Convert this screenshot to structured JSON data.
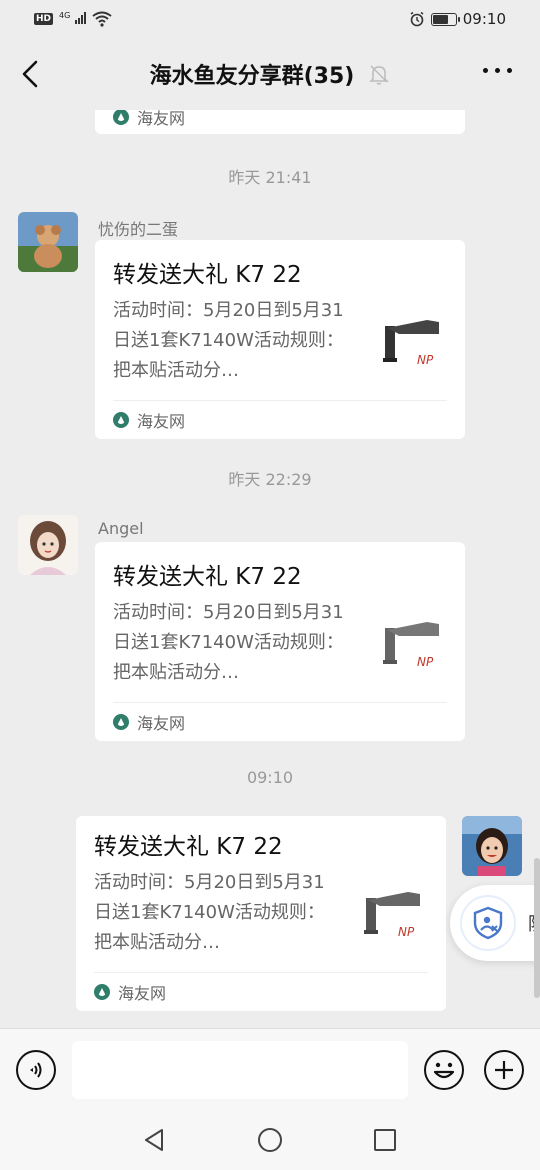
{
  "status_bar": {
    "hd": "HD",
    "network": "4G",
    "time": "09:10"
  },
  "header": {
    "title": "海水鱼友分享群(35)"
  },
  "top_card": {
    "source": "海友网"
  },
  "messages": [
    {
      "timestamp": "昨天 21:41",
      "sender": "忧伤的二蛋",
      "title": "转发送大礼 K7 22",
      "desc": "活动时间：5月20日到5月31日送1套K7140W活动规则：把本贴活动分…",
      "thumb_label": "NP",
      "source": "海友网"
    },
    {
      "timestamp": "昨天 22:29",
      "sender": "Angel",
      "title": "转发送大礼 K7 22",
      "desc": "活动时间：5月20日到5月31日送1套K7140W活动规则：把本贴活动分…",
      "thumb_label": "NP",
      "source": "海友网"
    },
    {
      "timestamp": "09:10",
      "sender": "",
      "title": "转发送大礼 K7 22",
      "desc": "活动时间：5月20日到5月31日送1套K7140W活动规则：把本贴活动分…",
      "thumb_label": "NP",
      "source": "海友网"
    }
  ],
  "floating": {
    "label": "防"
  },
  "input_bar": {
    "placeholder": ""
  }
}
